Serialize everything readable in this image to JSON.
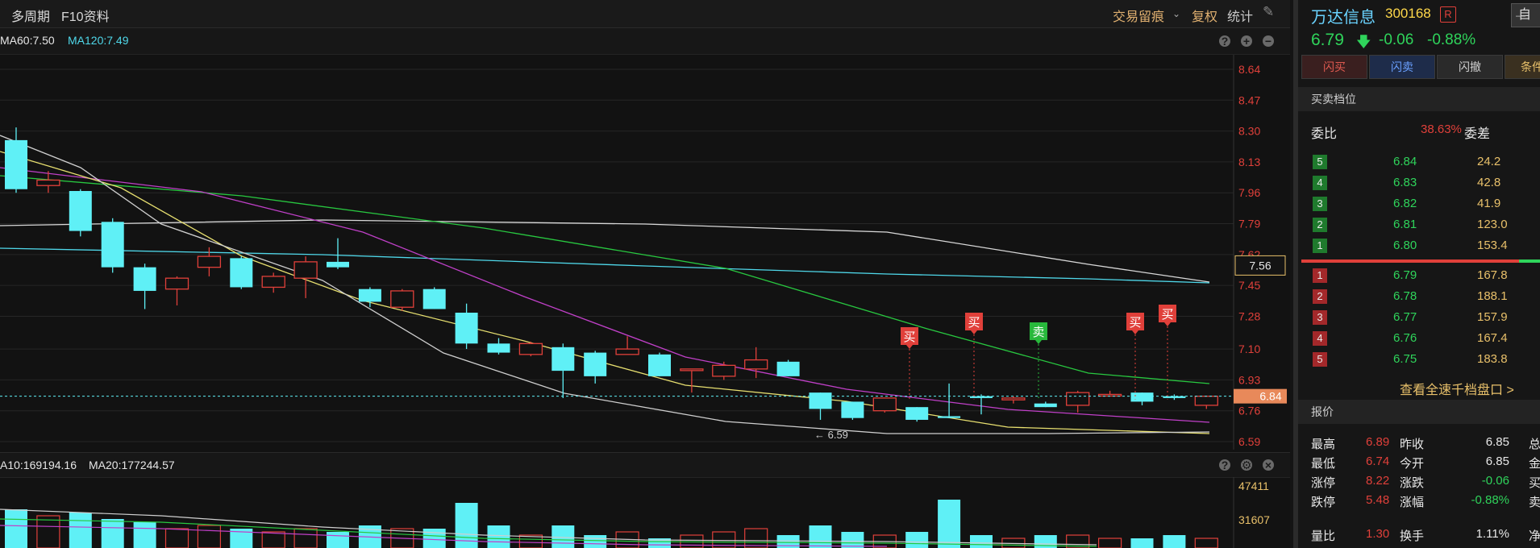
{
  "toolbar": {
    "multi_period": "多周期",
    "f10": "F10资料",
    "trade_marks": "交易留痕",
    "adjust": "复权",
    "stats": "统计"
  },
  "ma_bar": {
    "ma60": "MA60:7.50",
    "ma120": "MA120:7.49"
  },
  "vol_bar": {
    "ma10": "A10:169194.16",
    "ma20": "MA20:177244.57"
  },
  "price_axis": [
    "8.64",
    "8.47",
    "8.30",
    "8.13",
    "7.96",
    "7.79",
    "7.62",
    "7.45",
    "7.28",
    "7.10",
    "6.93",
    "6.76",
    "6.59"
  ],
  "vol_axis": [
    "47411",
    "31607"
  ],
  "crosshair_label": "7.56",
  "current_price_label": "6.84",
  "low_label": "6.59",
  "trade_markers": [
    "买",
    "买",
    "卖",
    "买",
    "买"
  ],
  "stock": {
    "name": "万达信息",
    "code": "300168",
    "badge": "R",
    "top_button": "自",
    "price": "6.79",
    "change": "-0.06",
    "change_pct": "-0.88%"
  },
  "actions": [
    "闪买",
    "闪卖",
    "闪撤",
    "条件下"
  ],
  "orderbook": {
    "title": "买卖档位",
    "ratio_label": "委比",
    "ratio_value": "38.63%",
    "diff_label": "委差",
    "asks": [
      {
        "idx": "5",
        "price": "6.84",
        "vol": "24.2"
      },
      {
        "idx": "4",
        "price": "6.83",
        "vol": "42.8"
      },
      {
        "idx": "3",
        "price": "6.82",
        "vol": "41.9"
      },
      {
        "idx": "2",
        "price": "6.81",
        "vol": "123.0"
      },
      {
        "idx": "1",
        "price": "6.80",
        "vol": "153.4"
      }
    ],
    "bids": [
      {
        "idx": "1",
        "price": "6.79",
        "vol": "167.8"
      },
      {
        "idx": "2",
        "price": "6.78",
        "vol": "188.1"
      },
      {
        "idx": "3",
        "price": "6.77",
        "vol": "157.9"
      },
      {
        "idx": "4",
        "price": "6.76",
        "vol": "167.4"
      },
      {
        "idx": "5",
        "price": "6.75",
        "vol": "183.8"
      }
    ],
    "view_all": "查看全速千档盘口 >"
  },
  "quote": {
    "title": "报价",
    "rows": [
      {
        "l1": "最高",
        "v1": "6.89",
        "l2": "昨收",
        "v2": "6.85",
        "l3": "总"
      },
      {
        "l1": "最低",
        "v1": "6.74",
        "l2": "今开",
        "v2": "6.85",
        "l3": "金"
      },
      {
        "l1": "涨停",
        "v1": "8.22",
        "l2": "涨跌",
        "v2": "-0.06",
        "l3": "买"
      },
      {
        "l1": "跌停",
        "v1": "5.48",
        "l2": "涨幅",
        "v2": "-0.88%",
        "l3": "卖"
      },
      {
        "l1": "量比",
        "v1": "1.30",
        "l2": "换手",
        "v2": "1.11%",
        "l3": "净"
      }
    ]
  },
  "chart_data": {
    "type": "candlestick",
    "y_range": [
      6.59,
      8.64
    ],
    "candles": [
      [
        8.25,
        7.98,
        8.32,
        7.96
      ],
      [
        8.0,
        8.03,
        8.08,
        7.96
      ],
      [
        7.97,
        7.75,
        7.98,
        7.72
      ],
      [
        7.8,
        7.55,
        7.82,
        7.52
      ],
      [
        7.55,
        7.42,
        7.57,
        7.32
      ],
      [
        7.43,
        7.49,
        7.5,
        7.34
      ],
      [
        7.55,
        7.61,
        7.66,
        7.5
      ],
      [
        7.6,
        7.44,
        7.61,
        7.43
      ],
      [
        7.44,
        7.5,
        7.52,
        7.41
      ],
      [
        7.49,
        7.58,
        7.61,
        7.38
      ],
      [
        7.58,
        7.55,
        7.71,
        7.54
      ],
      [
        7.43,
        7.36,
        7.44,
        7.33
      ],
      [
        7.33,
        7.42,
        7.43,
        7.31
      ],
      [
        7.43,
        7.32,
        7.44,
        7.32
      ],
      [
        7.3,
        7.13,
        7.35,
        7.1
      ],
      [
        7.13,
        7.08,
        7.16,
        7.07
      ],
      [
        7.07,
        7.13,
        7.14,
        7.06
      ],
      [
        7.11,
        6.98,
        7.13,
        6.83
      ],
      [
        7.08,
        6.95,
        7.09,
        6.91
      ],
      [
        7.07,
        7.1,
        7.17,
        7.07
      ],
      [
        7.07,
        6.95,
        7.08,
        6.95
      ],
      [
        6.99,
        6.99,
        6.99,
        6.86
      ],
      [
        6.95,
        7.01,
        7.03,
        6.93
      ],
      [
        6.99,
        7.04,
        7.11,
        6.94
      ],
      [
        7.03,
        6.95,
        7.04,
        6.95
      ],
      [
        6.86,
        6.77,
        6.86,
        6.71
      ],
      [
        6.81,
        6.72,
        6.81,
        6.71
      ],
      [
        6.76,
        6.83,
        6.83,
        6.75
      ],
      [
        6.78,
        6.71,
        6.78,
        6.7
      ],
      [
        6.73,
        6.72,
        6.91,
        6.72
      ],
      [
        6.84,
        6.83,
        6.85,
        6.74
      ],
      [
        6.82,
        6.83,
        6.84,
        6.8
      ],
      [
        6.8,
        6.78,
        6.81,
        6.78
      ],
      [
        6.79,
        6.86,
        6.87,
        6.75
      ],
      [
        6.85,
        6.85,
        6.87,
        6.84
      ],
      [
        6.86,
        6.81,
        6.86,
        6.79
      ],
      [
        6.84,
        6.83,
        6.85,
        6.82
      ],
      [
        6.79,
        6.84,
        6.84,
        6.77
      ]
    ],
    "volume_ma": "A10:169194.16 / MA20:177244.57"
  }
}
